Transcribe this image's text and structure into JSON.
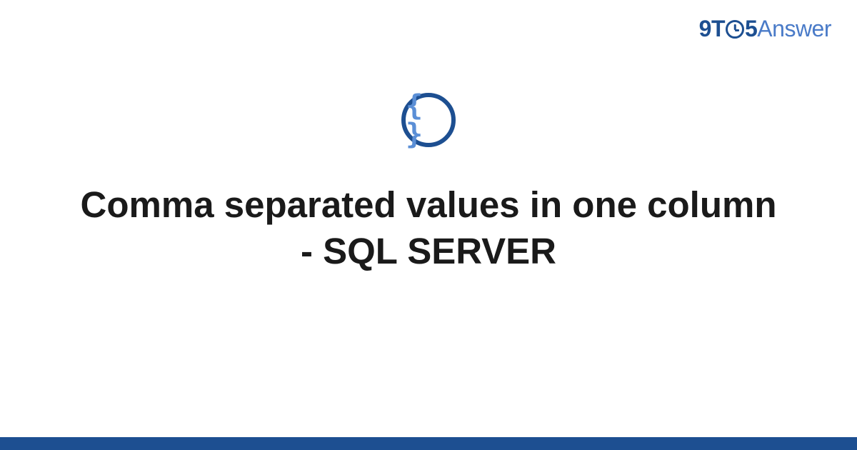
{
  "logo": {
    "part1": "9T",
    "part2": "5",
    "part3": "Answer"
  },
  "topic_icon": {
    "symbol": "{ }",
    "name": "code-braces-icon"
  },
  "title": "Comma separated values in one column - SQL SERVER",
  "colors": {
    "brand_dark": "#1d4f91",
    "brand_light": "#4a7bc8",
    "icon_fill": "#5b8fd6",
    "text": "#1a1a1a"
  }
}
